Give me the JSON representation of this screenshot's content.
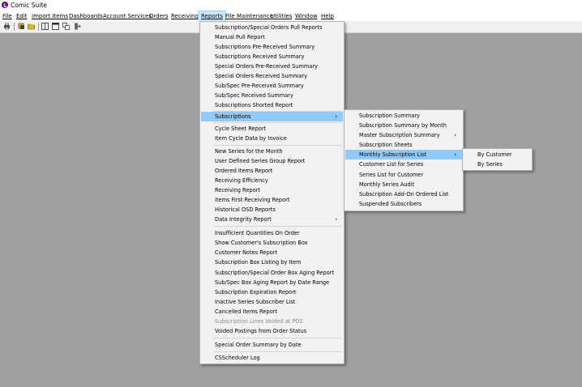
{
  "window": {
    "title": "Comic Suite"
  },
  "menubar": [
    "File",
    "Edit",
    "Import Items",
    "Dashboards",
    "Account Services",
    "Orders",
    "Receiving",
    "Reports",
    "File Maintenance",
    "Utilities",
    "Window",
    "Help"
  ],
  "toolbar": {
    "icons": [
      "print-icon",
      "stamp-icon",
      "folder-icon",
      "split-window-icon",
      "window-icon",
      "cascade-icon",
      "exit-icon"
    ]
  },
  "reports_menu": [
    "Subscription/Special Orders Pull Reports",
    "Manual Pull Report",
    "Subscriptions Pre-Received Summary",
    "Subscriptions Received Summary",
    "Special Orders Pre-Received Summary",
    "Special Orders Received Summary",
    "Sub/Spec Pre-Received Summary",
    "Sub/Spec Received Summary",
    "Subscriptions Shorted Report",
    "Subscriptions",
    "Cycle Sheet Report",
    "Item Cycle Data by Invoice",
    "New Series for the Month",
    "User Defined Series Group Report",
    "Ordered Items Report",
    "Receiving Efficiency",
    "Receiving Report",
    "Items First Receiving Report",
    "Historical OSD Reports",
    "Data Integrity Report",
    "Insufficient Quantities On Order",
    "Show Customer's Subscription Box",
    "Customer Notes Report",
    "Subscription Box Listing by Item",
    "Subscription/Special Order Box Aging Report",
    "Sub/Spec Box Aging Report by Date Range",
    "Subscription Expiration Report",
    "Inactive Series Subscriber List",
    "Cancelled Items Report",
    "Subscription Lines Voided at POS",
    "Voided Postings from Order Status",
    "Special Order Summary by Date",
    "CSScheduler Log"
  ],
  "subscriptions_menu": [
    "Subscription Summary",
    "Subscription Summary by Month",
    "Master Subscription Summary",
    "Subscription Sheets",
    "Monthly Subscription List",
    "Customer List for Series",
    "Series List for Customer",
    "Monthly Series Audit",
    "Subscription Add-On Ordered List",
    "Suspended Subscribers"
  ],
  "monthly_menu": [
    "By Customer",
    "By Series"
  ]
}
